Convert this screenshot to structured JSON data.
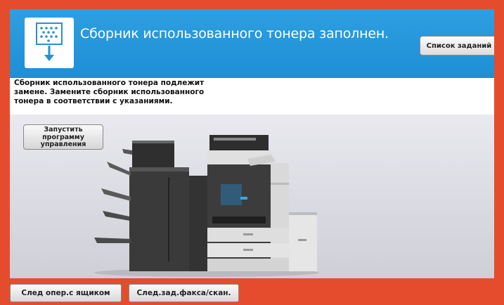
{
  "header": {
    "title": "Сборник использованного тонера заполнен.",
    "job_list_label": "Список заданий",
    "icon": "waste-toner-box-icon",
    "color": "#2196d9"
  },
  "message": {
    "line1": "Сборник использованного тонера подлежит",
    "line2": "замене. Замените сборник использованного",
    "line3": "тонера в соответствии с указаниями."
  },
  "guide_button": {
    "line1": "Запустить",
    "line2": "программу",
    "line3": "управления"
  },
  "illustration": "printer-illustration",
  "footer": {
    "box_label": "След опер.с ящиком",
    "fax_label": "След.зад.факса/скан.",
    "color": "#e44c2d"
  }
}
